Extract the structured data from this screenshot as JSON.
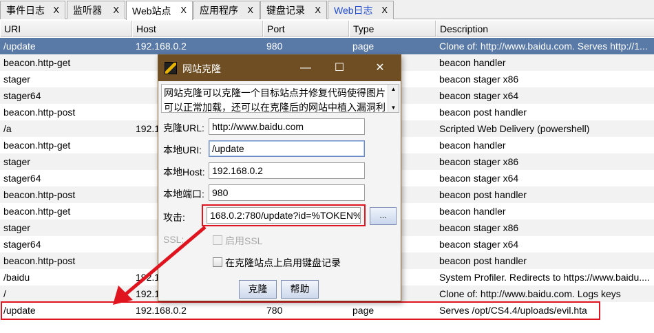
{
  "tabs": [
    {
      "label": "事件日志",
      "close": "X"
    },
    {
      "label": "监听器",
      "close": "X"
    },
    {
      "label": "Web站点",
      "close": "X"
    },
    {
      "label": "应用程序",
      "close": "X"
    },
    {
      "label": "键盘记录",
      "close": "X"
    },
    {
      "label": "Web日志",
      "close": "X"
    }
  ],
  "table": {
    "columns": [
      "URI",
      "Host",
      "Port",
      "Type",
      "Description"
    ],
    "rows": [
      {
        "uri": "/update",
        "host": "192.168.0.2",
        "port": "980",
        "type": "page",
        "desc": "Clone of: http://www.baidu.com. Serves http://1..."
      },
      {
        "uri": "beacon.http-get",
        "host": "",
        "port": "",
        "type": "",
        "desc": "beacon handler"
      },
      {
        "uri": "stager",
        "host": "",
        "port": "",
        "type": "",
        "desc": "beacon stager x86"
      },
      {
        "uri": "stager64",
        "host": "",
        "port": "",
        "type": "",
        "desc": "beacon stager x64"
      },
      {
        "uri": "beacon.http-post",
        "host": "",
        "port": "",
        "type": "",
        "desc": "beacon post handler"
      },
      {
        "uri": "/a",
        "host": "192.1",
        "port": "",
        "type": "",
        "desc": "Scripted Web Delivery (powershell)"
      },
      {
        "uri": "beacon.http-get",
        "host": "",
        "port": "",
        "type": "",
        "desc": "beacon handler"
      },
      {
        "uri": "stager",
        "host": "",
        "port": "",
        "type": "",
        "desc": "beacon stager x86"
      },
      {
        "uri": "stager64",
        "host": "",
        "port": "",
        "type": "",
        "desc": "beacon stager x64"
      },
      {
        "uri": "beacon.http-post",
        "host": "",
        "port": "",
        "type": "",
        "desc": "beacon post handler"
      },
      {
        "uri": "beacon.http-get",
        "host": "",
        "port": "",
        "type": "",
        "desc": "beacon handler"
      },
      {
        "uri": "stager",
        "host": "",
        "port": "",
        "type": "",
        "desc": "beacon stager x86"
      },
      {
        "uri": "stager64",
        "host": "",
        "port": "",
        "type": "",
        "desc": "beacon stager x64"
      },
      {
        "uri": "beacon.http-post",
        "host": "",
        "port": "",
        "type": "",
        "desc": "beacon post handler"
      },
      {
        "uri": "/baidu",
        "host": "192.1",
        "port": "",
        "type": "",
        "desc": "System Profiler. Redirects to https://www.baidu...."
      },
      {
        "uri": "/",
        "host": "192.1",
        "port": "",
        "type": "",
        "desc": "Clone of: http://www.baidu.com. Logs keys"
      },
      {
        "uri": "/update",
        "host": "192.168.0.2",
        "port": "780",
        "type": "page",
        "desc": "Serves /opt/CS4.4/uploads/evil.hta"
      }
    ]
  },
  "dialog": {
    "title": "网站克隆",
    "controls": {
      "minimize": "—",
      "maximize": "☐",
      "close": "✕"
    },
    "description_line1": "网站克隆可以克隆一个目标站点并修复代码使得图片",
    "description_line2": "可以正常加载，还可以在克隆后的网站中植入漏洞利",
    "clone_url_label": "克隆URL:",
    "clone_url_value": "http://www.baidu.com",
    "local_uri_label": "本地URI:",
    "local_uri_value": "/update",
    "local_host_label": "本地Host:",
    "local_host_value": "192.168.0.2",
    "local_port_label": "本地端口:",
    "local_port_value": "980",
    "attack_label": "攻击:",
    "attack_value": "168.0.2:780/update?id=%TOKEN%",
    "browse_label": "...",
    "ssl_label": "SSL:",
    "ssl_checkbox_label": "启用SSL",
    "keylog_checkbox_label": "在克隆站点上启用键盘记录",
    "clone_button": "克隆",
    "help_button": "帮助"
  },
  "colors": {
    "selected_row": "#5979a7",
    "dialog_title": "#6e4e22",
    "highlight": "#e0141e",
    "web_log_tab": "#1e4bd2"
  }
}
